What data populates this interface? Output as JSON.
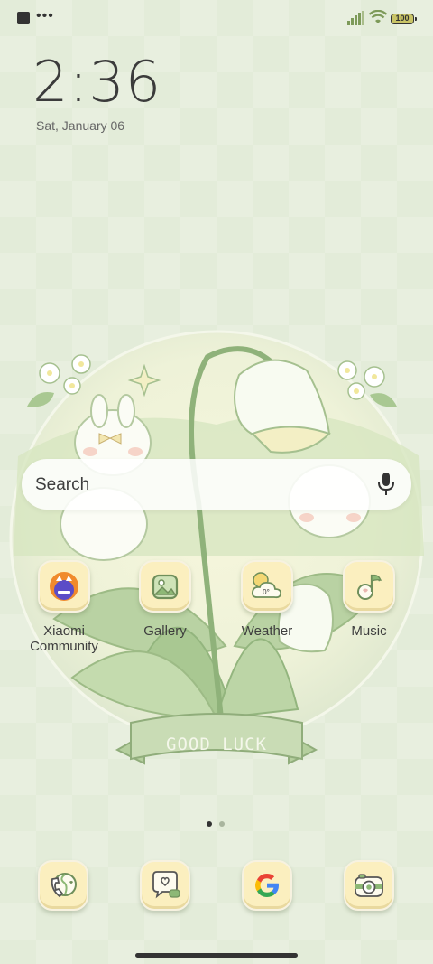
{
  "status_bar": {
    "battery": "100"
  },
  "clock": {
    "time": "2:36",
    "date": "Sat, January 06"
  },
  "search": {
    "placeholder": "Search"
  },
  "wallpaper": {
    "banner_text": "GOOD LUCK"
  },
  "apps": [
    {
      "label_line1": "Xiaomi",
      "label_line2": "Community",
      "icon": "xiaomi-community-icon"
    },
    {
      "label_line1": "Gallery",
      "label_line2": "",
      "icon": "gallery-icon"
    },
    {
      "label_line1": "Weather",
      "label_line2": "",
      "icon": "weather-icon",
      "badge": "0°"
    },
    {
      "label_line1": "Music",
      "label_line2": "",
      "icon": "music-icon"
    }
  ],
  "dock": [
    {
      "icon": "phone-icon"
    },
    {
      "icon": "messages-icon"
    },
    {
      "icon": "google-icon"
    },
    {
      "icon": "camera-icon"
    }
  ],
  "pager": {
    "pages": 2,
    "current": 1
  },
  "colors": {
    "background": "#e3ecd9",
    "icon_bg": "#fbefbf",
    "accent_green": "#7ea36b"
  }
}
